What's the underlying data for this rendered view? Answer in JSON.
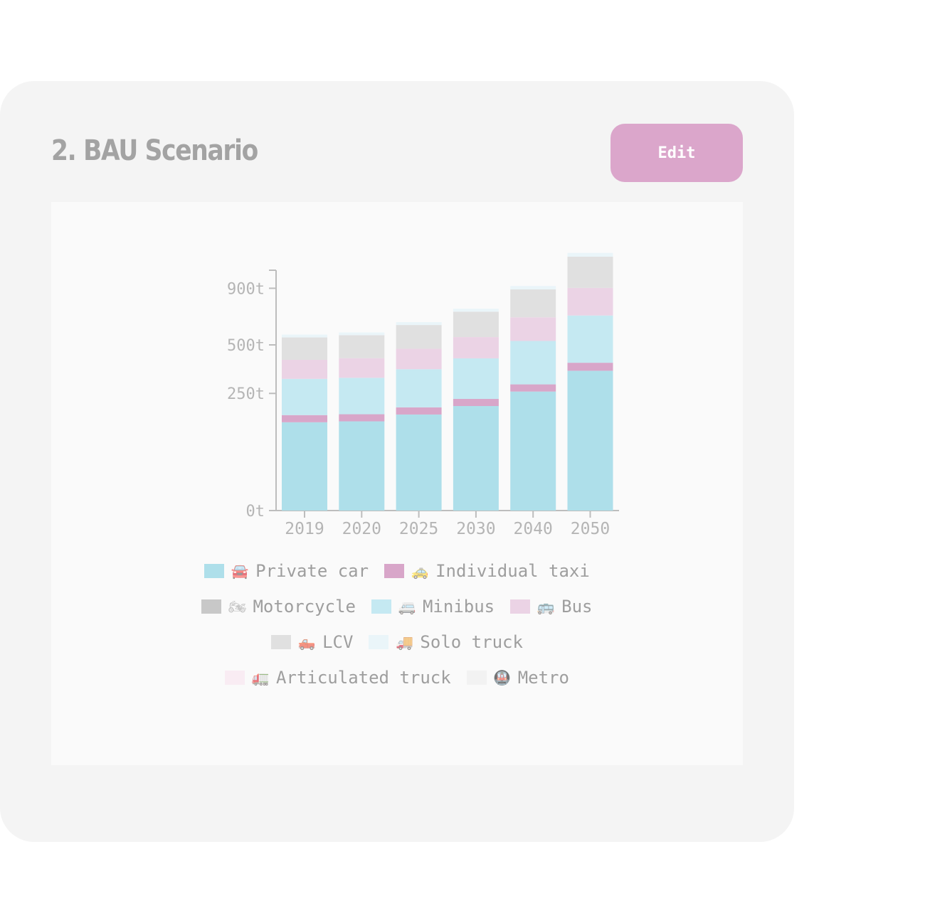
{
  "card": {
    "title": "2. BAU Scenario",
    "edit_label": "Edit",
    "edit_color": "#dba6cb"
  },
  "chart_data": {
    "type": "bar",
    "stacked": true,
    "categories": [
      "2019",
      "2020",
      "2025",
      "2030",
      "2040",
      "2050"
    ],
    "y_ticks": [
      {
        "value": 0,
        "label": "0t"
      },
      {
        "value": 250,
        "label": "250t"
      },
      {
        "value": 500,
        "label": "500t"
      },
      {
        "value": 900,
        "label": "900t"
      }
    ],
    "y_scale": "sqrt",
    "ylim": [
      0,
      1000
    ],
    "series": [
      {
        "name": "Private car",
        "icon": "car-icon",
        "glyph": "🚘",
        "color": "#aedfea",
        "values": [
          142,
          145,
          168,
          199,
          258,
          356
        ]
      },
      {
        "name": "Individual taxi",
        "icon": "taxi-icon",
        "glyph": "🚕",
        "color": "#d8a6c9",
        "values": [
          24,
          24,
          26,
          28,
          32,
          42
        ]
      },
      {
        "name": "Motorcycle",
        "icon": "motorcycle-icon",
        "glyph": "🏍",
        "color": "#c8c8c8",
        "values": [
          0,
          0,
          0,
          0,
          0,
          0
        ]
      },
      {
        "name": "Minibus",
        "icon": "minibus-icon",
        "glyph": "🚐",
        "color": "#c5e9f2",
        "values": [
          150,
          152,
          170,
          195,
          234,
          295
        ]
      },
      {
        "name": "Bus",
        "icon": "bus-icon",
        "glyph": "🚌",
        "color": "#ebd3e5",
        "values": [
          98,
          102,
          113,
          126,
          156,
          210
        ]
      },
      {
        "name": "LCV",
        "icon": "pickup-truck-icon",
        "glyph": "🛻",
        "color": "#e0e0e0",
        "values": [
          132,
          137,
          150,
          172,
          211,
          271
        ]
      },
      {
        "name": "Solo truck",
        "icon": "delivery-truck-icon",
        "glyph": "🚚",
        "color": "#eaf5f9",
        "values": [
          18,
          18,
          20,
          22,
          27,
          35
        ]
      },
      {
        "name": "Articulated truck",
        "icon": "articulated-truck-icon",
        "glyph": "🚛",
        "color": "#f9ecf3",
        "values": [
          0,
          0,
          0,
          0,
          0,
          0
        ]
      },
      {
        "name": "Metro",
        "icon": "metro-icon",
        "glyph": "🚇",
        "color": "#f2f2f2",
        "values": [
          0,
          0,
          0,
          0,
          0,
          0
        ]
      }
    ],
    "legend_rows": [
      [
        0,
        1
      ],
      [
        2,
        3,
        4
      ],
      [
        5,
        6
      ],
      [
        7,
        8
      ]
    ],
    "legend_position": "bottom",
    "grid": false
  }
}
